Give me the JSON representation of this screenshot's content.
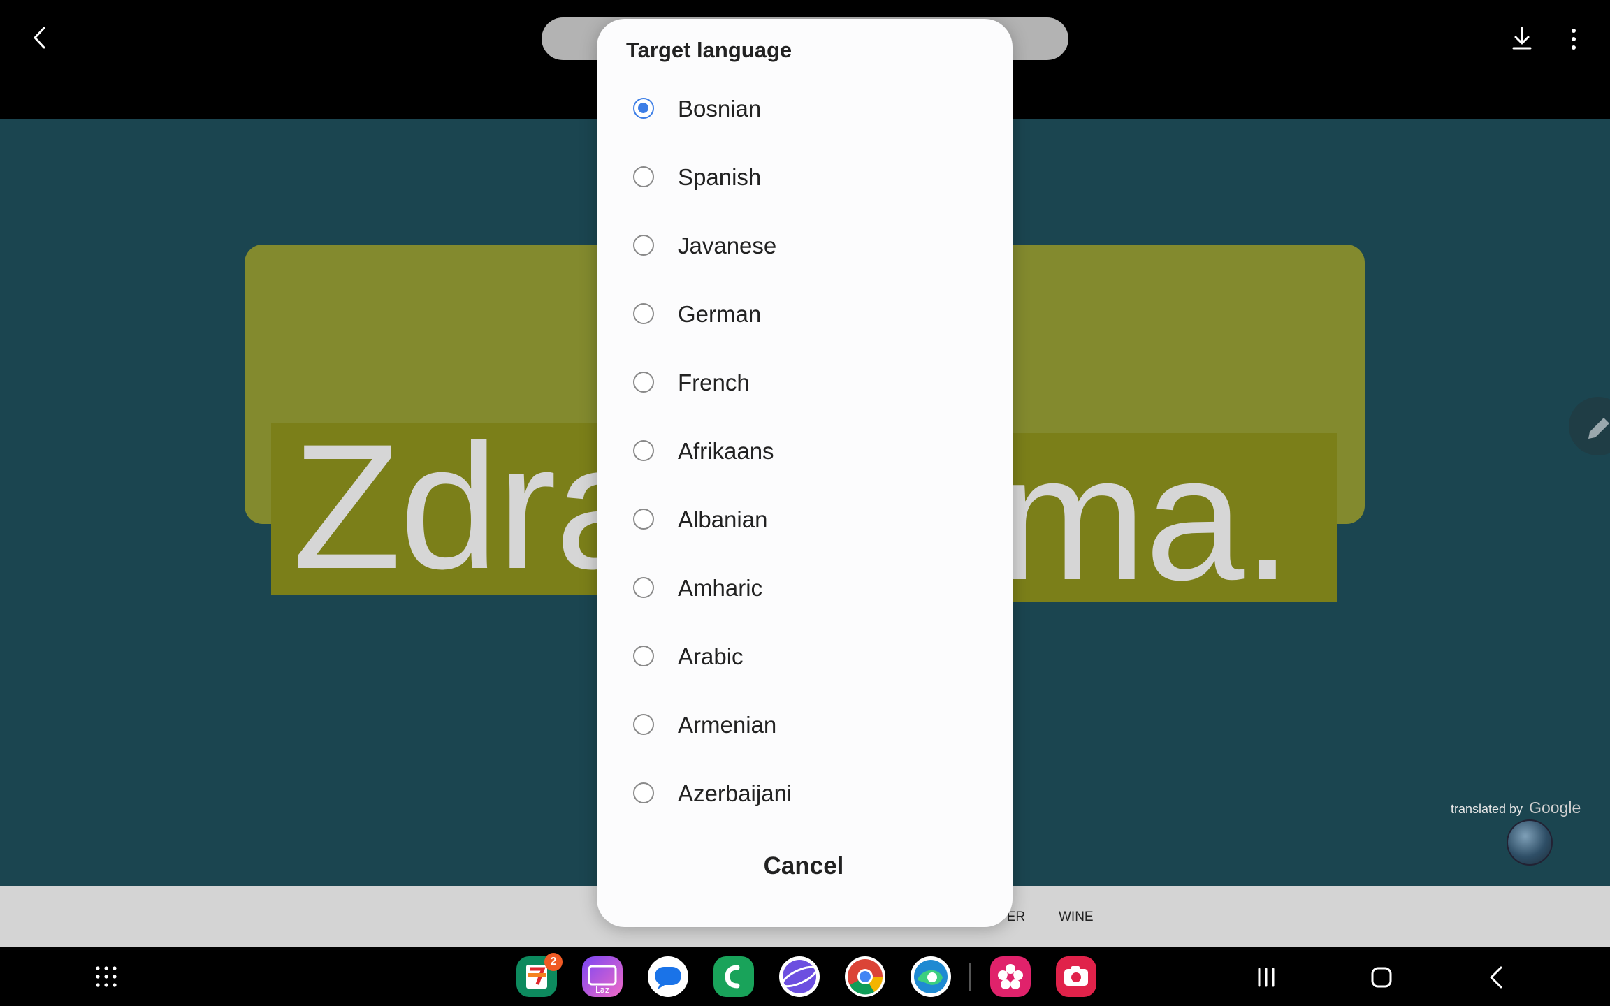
{
  "viewer": {
    "sign_text_left": "Zdra",
    "sign_text_right": "ma.",
    "credit_prefix": "translated by",
    "credit_brand": "Google"
  },
  "strip": {
    "label_1": "VER",
    "label_2": "WINE"
  },
  "dialog": {
    "title": "Target language",
    "selected": "Bosnian",
    "recent_languages": [
      "Bosnian",
      "Spanish",
      "Javanese",
      "German",
      "French"
    ],
    "all_languages": [
      "Afrikaans",
      "Albanian",
      "Amharic",
      "Arabic",
      "Armenian",
      "Azerbaijani"
    ],
    "cancel_label": "Cancel"
  },
  "taskbar": {
    "badge_count": "2",
    "apps": [
      "7-Eleven",
      "Lazada",
      "Messages",
      "Phone",
      "Samsung Internet",
      "Chrome",
      "Edge",
      "Blossom",
      "Camera"
    ]
  },
  "colors": {
    "accent": "#3d7ee6",
    "viewer_bg": "#1b4550",
    "sign_bg": "#838a2e"
  }
}
